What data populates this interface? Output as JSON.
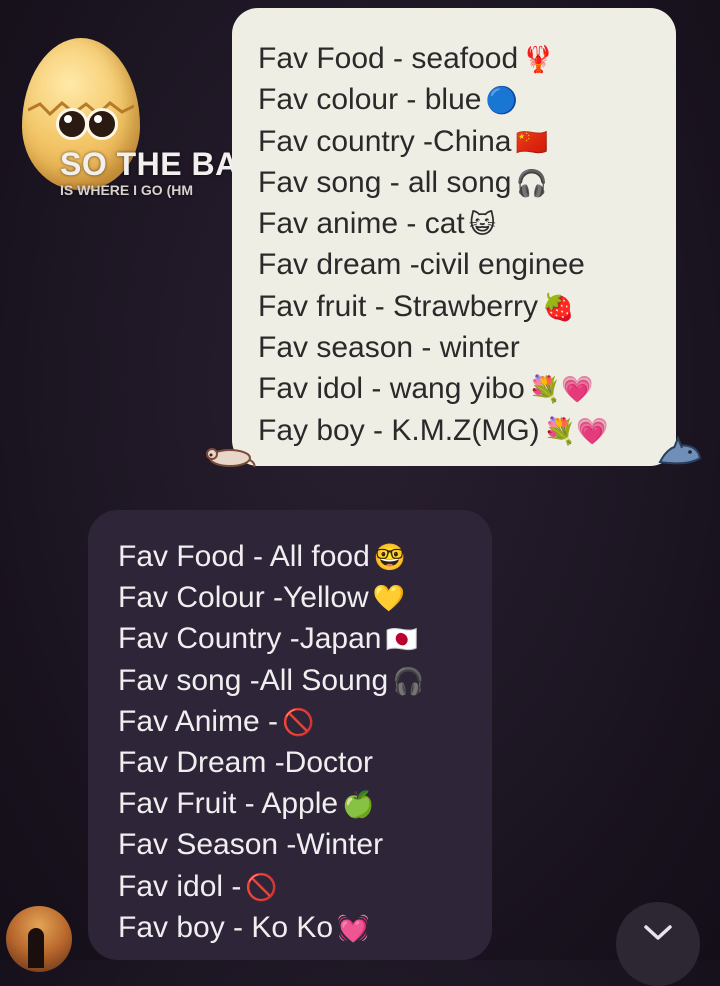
{
  "sticker": {
    "caption_line1": "SO THE BA",
    "caption_line2": "IS WHERE I GO (HM"
  },
  "received_message": {
    "lines": [
      {
        "text": "Fav Food - seafood",
        "emoji": "🦞"
      },
      {
        "text": "Fav colour - blue",
        "emoji": "🔵"
      },
      {
        "text": "Fav country -China",
        "emoji": "🇨🇳"
      },
      {
        "text": "Fav song - all song",
        "emoji": "🎧"
      },
      {
        "text": "Fav anime - cat",
        "emoji": "😺"
      },
      {
        "text": "Fav dream -civil enginee",
        "emoji": ""
      },
      {
        "text": "Fav fruit - Strawberry",
        "emoji": "🍓"
      },
      {
        "text": "Fav season - winter",
        "emoji": ""
      },
      {
        "text": "Fav idol - wang yibo",
        "emoji": "💐💗"
      },
      {
        "text": "Fay boy - K.M.Z(MG)",
        "emoji": "💐💗"
      }
    ]
  },
  "sent_message": {
    "lines": [
      {
        "text": "Fav Food - All food",
        "emoji": "🤓"
      },
      {
        "text": "Fav Colour -Yellow",
        "emoji": "💛"
      },
      {
        "text": "Fav Country -Japan",
        "emoji": "🇯🇵"
      },
      {
        "text": "Fav song -All Soung",
        "emoji": "🎧"
      },
      {
        "text": "Fav Anime -",
        "emoji": "🚫"
      },
      {
        "text": "Fav Dream -Doctor",
        "emoji": ""
      },
      {
        "text": "Fav Fruit - Apple",
        "emoji": "🍏"
      },
      {
        "text": "Fav Season -Winter",
        "emoji": ""
      },
      {
        "text": "Fav idol -",
        "emoji": "🚫"
      },
      {
        "text": "Fav boy - Ko Ko",
        "emoji": "💓"
      }
    ]
  },
  "icons": {
    "egg_sticker": "egg-face-sticker",
    "mouse_sticker": "mouse-sticker",
    "shark_sticker": "shark-sticker",
    "scroll_down": "chevron-down-icon"
  },
  "colors": {
    "background": "#1c1522",
    "received_bubble": "#efeee5",
    "sent_bubble": "#2e2638"
  }
}
